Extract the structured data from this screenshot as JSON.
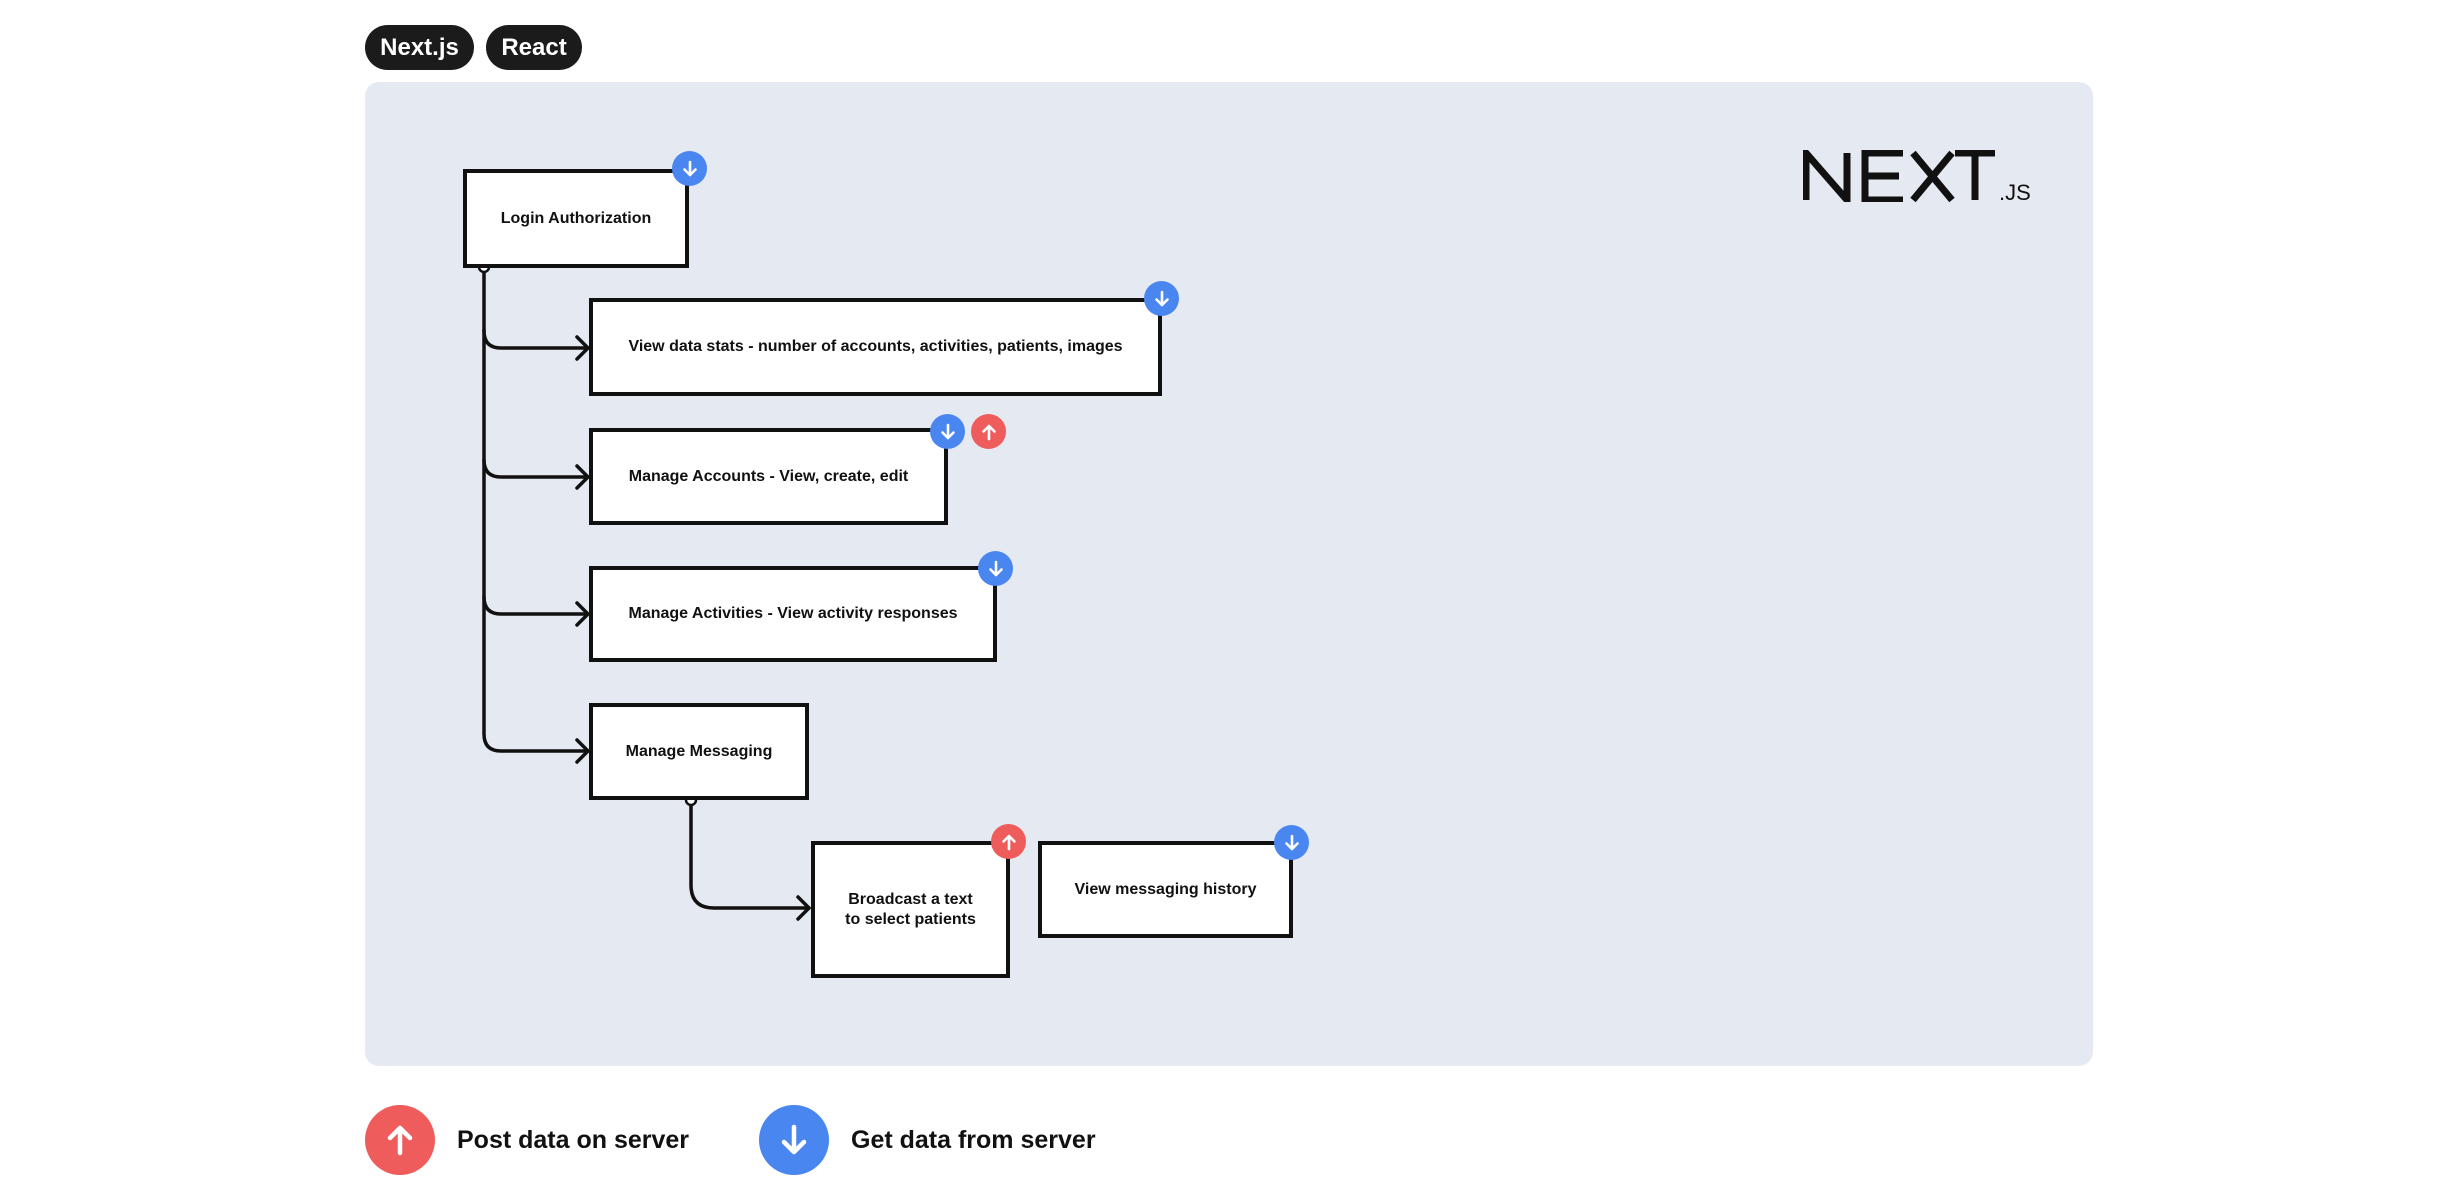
{
  "tags": [
    {
      "label": "Next.js"
    },
    {
      "label": "React"
    }
  ],
  "logo": {
    "main": "NEXT",
    "suffix": ".JS"
  },
  "colors": {
    "post": "#ee5c5c",
    "get": "#4a86f0",
    "panel_bg": "#e5e9f1",
    "stroke": "#111111"
  },
  "nodes": [
    {
      "id": "login",
      "label": "Login Authorization",
      "badges": [
        "get-icon"
      ]
    },
    {
      "id": "stats",
      "label": "View data stats - number of accounts, activities, patients, images",
      "badges": [
        "get-icon"
      ]
    },
    {
      "id": "accounts",
      "label": "Manage Accounts - View, create, edit",
      "badges": [
        "get-icon",
        "post-icon"
      ]
    },
    {
      "id": "activities",
      "label": "Manage Activities - View activity responses",
      "badges": [
        "get-icon"
      ]
    },
    {
      "id": "messaging",
      "label": "Manage Messaging",
      "badges": []
    },
    {
      "id": "broadcast",
      "label": "Broadcast a text to select patients",
      "badges": [
        "post-icon"
      ]
    },
    {
      "id": "history",
      "label": "View messaging history",
      "badges": [
        "get-icon"
      ]
    }
  ],
  "edges": [
    {
      "from": "login",
      "to": "stats"
    },
    {
      "from": "login",
      "to": "accounts"
    },
    {
      "from": "login",
      "to": "activities"
    },
    {
      "from": "login",
      "to": "messaging"
    },
    {
      "from": "messaging",
      "to": "broadcast"
    }
  ],
  "legend": {
    "post_label": "Post data on server",
    "get_label": "Get data from server"
  }
}
